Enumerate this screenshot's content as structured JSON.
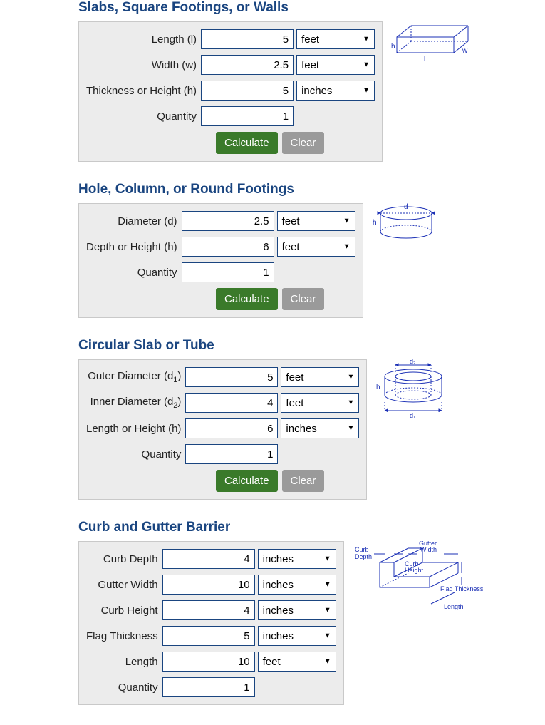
{
  "sections": {
    "slab": {
      "title": "Slabs, Square Footings, or Walls",
      "fields": {
        "length": {
          "label": "Length (l)",
          "value": "5",
          "unit": "feet"
        },
        "width": {
          "label": "Width (w)",
          "value": "2.5",
          "unit": "feet"
        },
        "thickness": {
          "label": "Thickness or Height (h)",
          "value": "5",
          "unit": "inches"
        },
        "quantity": {
          "label": "Quantity",
          "value": "1"
        }
      }
    },
    "hole": {
      "title": "Hole, Column, or Round Footings",
      "fields": {
        "diameter": {
          "label": "Diameter (d)",
          "value": "2.5",
          "unit": "feet"
        },
        "depth": {
          "label": "Depth or Height (h)",
          "value": "6",
          "unit": "feet"
        },
        "quantity": {
          "label": "Quantity",
          "value": "1"
        }
      }
    },
    "tube": {
      "title": "Circular Slab or Tube",
      "fields": {
        "outer": {
          "label_pre": "Outer Diameter (d",
          "label_sub": "1",
          "label_post": ")",
          "value": "5",
          "unit": "feet"
        },
        "inner": {
          "label_pre": "Inner Diameter (d",
          "label_sub": "2",
          "label_post": ")",
          "value": "4",
          "unit": "feet"
        },
        "length": {
          "label": "Length or Height (h)",
          "value": "6",
          "unit": "inches"
        },
        "quantity": {
          "label": "Quantity",
          "value": "1"
        }
      }
    },
    "curb": {
      "title": "Curb and Gutter Barrier",
      "fields": {
        "curb_depth": {
          "label": "Curb Depth",
          "value": "4",
          "unit": "inches"
        },
        "gutter_width": {
          "label": "Gutter Width",
          "value": "10",
          "unit": "inches"
        },
        "curb_height": {
          "label": "Curb Height",
          "value": "4",
          "unit": "inches"
        },
        "flag_thickness": {
          "label": "Flag Thickness",
          "value": "5",
          "unit": "inches"
        },
        "length": {
          "label": "Length",
          "value": "10",
          "unit": "feet"
        },
        "quantity": {
          "label": "Quantity",
          "value": "1"
        }
      }
    }
  },
  "buttons": {
    "calculate": "Calculate",
    "clear": "Clear"
  },
  "diagram_labels": {
    "slab": {
      "h": "h",
      "l": "l",
      "w": "w"
    },
    "hole": {
      "d": "d",
      "h": "h"
    },
    "tube": {
      "d1": "d₁",
      "d2": "d₂",
      "h": "h"
    },
    "curb": {
      "curb_depth": "Curb\nDepth",
      "gutter_width": "Gutter\nWidth",
      "curb_height": "Curb\nHeight",
      "flag_thickness": "Flag Thickness",
      "length": "Length"
    }
  }
}
